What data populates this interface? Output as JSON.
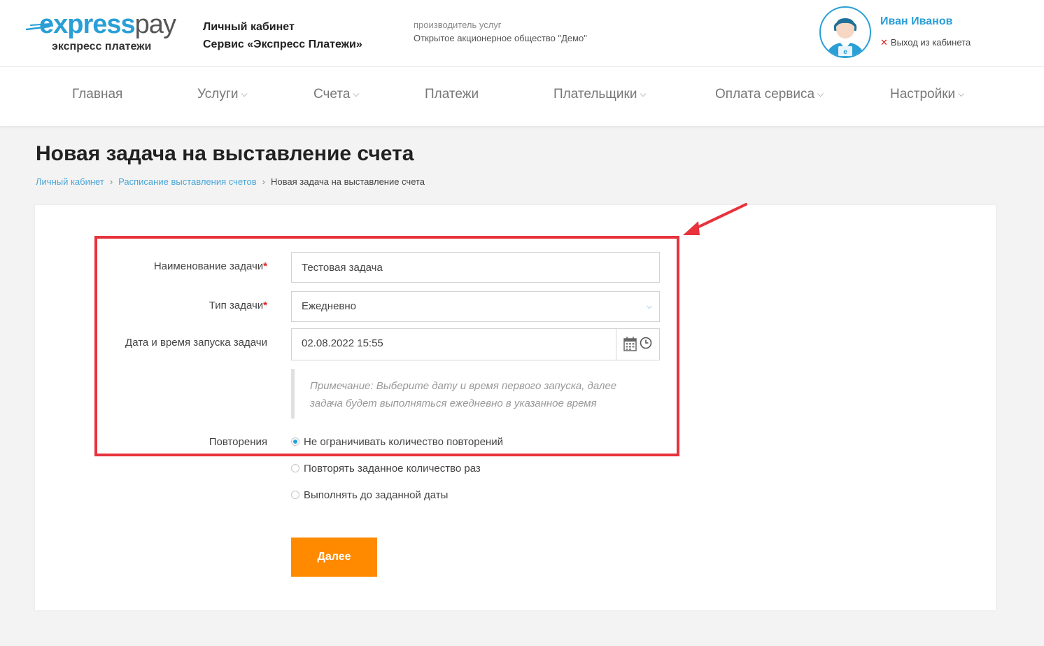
{
  "header": {
    "logo_express": "express",
    "logo_pay": "pay",
    "logo_sub": "экспресс платежи",
    "cabinet_line1": "Личный кабинет",
    "cabinet_line2": "Сервис «Экспресс Платежи»",
    "provider_label": "производитель услуг",
    "provider_name": "Открытое акционерное общество \"Демо\"",
    "user_name": "Иван Иванов",
    "logout_label": "Выход из кабинета"
  },
  "nav": {
    "items": [
      {
        "label": "Главная"
      },
      {
        "label": "Услуги"
      },
      {
        "label": "Счета"
      },
      {
        "label": "Платежи"
      },
      {
        "label": "Плательщики"
      },
      {
        "label": "Оплата сервиса"
      },
      {
        "label": "Настройки"
      }
    ]
  },
  "page": {
    "title": "Новая задача на выставление счета",
    "breadcrumb": [
      "Личный кабинет",
      "Расписание выставления счетов",
      "Новая задача на выставление счета"
    ]
  },
  "form": {
    "task_name_label": "Наименование задачи",
    "task_name_value": "Тестовая задача",
    "task_type_label": "Тип задачи",
    "task_type_value": "Ежедневно",
    "start_label": "Дата и время запуска задачи",
    "start_value": "02.08.2022 15:55",
    "note_line1": "Примечание: Выберите дату и время первого запуска, далее",
    "note_line2": "задача будет выполняться ежедневно в указанное время",
    "repeat_label": "Повторения",
    "repeat_options": [
      "Не ограничивать количество повторений",
      "Повторять заданное количество раз",
      "Выполнять до заданной даты"
    ],
    "next_label": "Далее",
    "required_mark": "*"
  },
  "colors": {
    "accent": "#2a9fd6",
    "button": "#ff8a00",
    "highlight": "#e8323c"
  }
}
